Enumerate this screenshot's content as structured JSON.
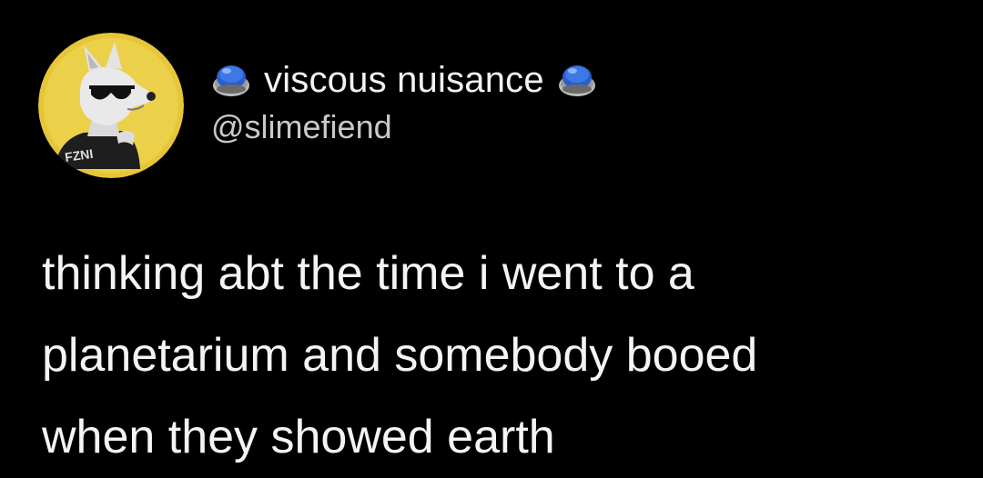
{
  "tweet": {
    "author": {
      "display_name": "viscous nuisance",
      "handle": "@slimefiend",
      "avatar_icon": "wolf-with-sunglasses-avatar",
      "avatar_shirt_text": "FZNI",
      "name_emoji": "blue-button-emoji"
    },
    "text_lines": [
      "thinking abt the time i went to a",
      "planetarium and somebody booed",
      "when they showed earth"
    ]
  },
  "colors": {
    "background": "#000000",
    "avatar_background": "#e8c93a",
    "emoji_blue": "#3a6fd8",
    "text": "#f4f4f4",
    "handle_text": "#c9c9c9"
  }
}
